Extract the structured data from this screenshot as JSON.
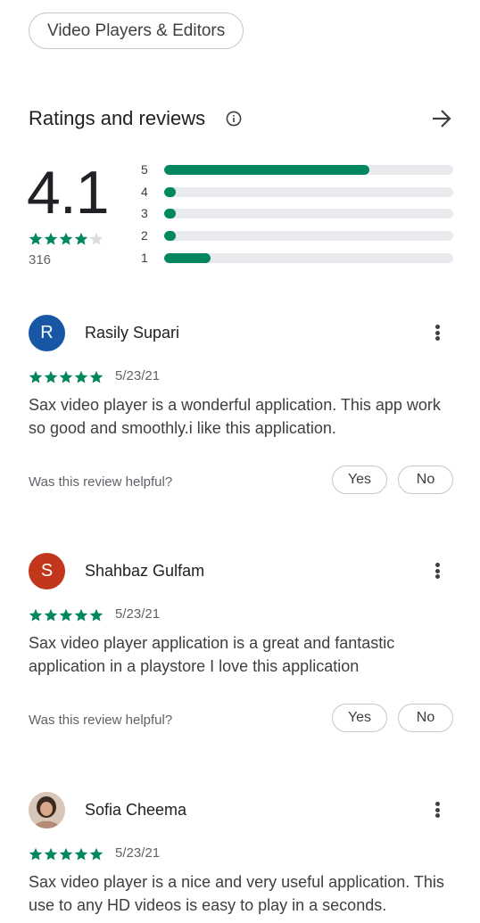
{
  "category_chip": "Video Players & Editors",
  "ratings": {
    "title": "Ratings and reviews",
    "average": "4.1",
    "average_value": 4.1,
    "count": "316",
    "distribution": [
      {
        "label": "5",
        "fraction": 0.71
      },
      {
        "label": "4",
        "fraction": 0.02
      },
      {
        "label": "3",
        "fraction": 0.02
      },
      {
        "label": "2",
        "fraction": 0.02
      },
      {
        "label": "1",
        "fraction": 0.16
      }
    ]
  },
  "colors": {
    "accent": "#01875f",
    "track": "#e8eaed"
  },
  "reviews": [
    {
      "initial": "R",
      "avatar_color": "#1757a6",
      "name": "Rasily Supari",
      "rating": 5,
      "date": "5/23/21",
      "text": "Sax video player is a wonderful application. This app work so good and smoothly.i like this application.",
      "helpful_prompt": "Was this review helpful?",
      "yes_label": "Yes",
      "no_label": "No"
    },
    {
      "initial": "S",
      "avatar_color": "#c2361b",
      "name": "Shahbaz Gulfam",
      "rating": 5,
      "date": "5/23/21",
      "text": "Sax video player application is a great and fantastic application in a playstore I love this application",
      "helpful_prompt": "Was this review helpful?",
      "yes_label": "Yes",
      "no_label": "No"
    },
    {
      "initial": "",
      "avatar_color": "#8b7a6c",
      "name": "Sofia Cheema",
      "rating": 5,
      "date": "5/23/21",
      "text": "Sax video player is a nice and very useful application. This use to any HD videos is easy to play in a seconds."
    }
  ]
}
